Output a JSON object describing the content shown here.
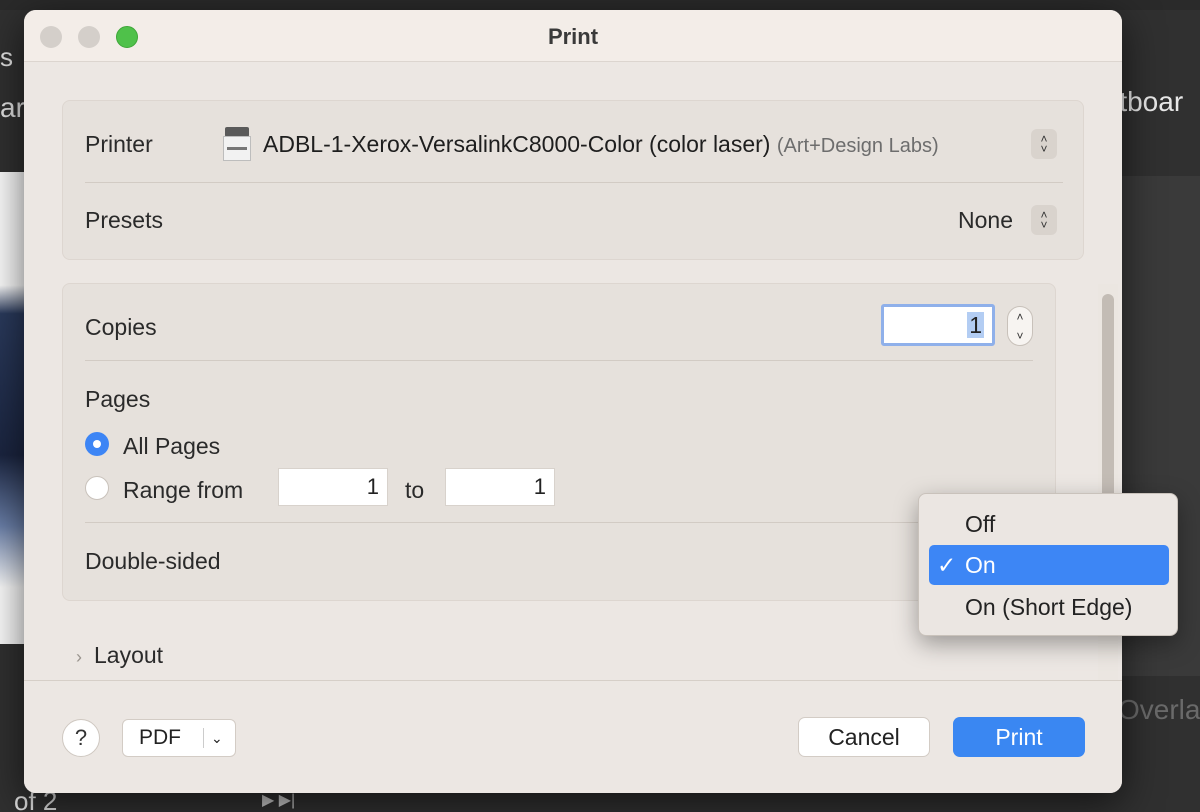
{
  "background": {
    "left_top": "s",
    "left_mid": "ar",
    "right_top": "rtboar",
    "right_bottom": "Overla",
    "page_indicator": "of 2"
  },
  "dialog": {
    "title": "Print",
    "printer": {
      "label": "Printer",
      "name": "ADBL-1-Xerox-VersalinkC8000-Color (color laser)",
      "location": "(Art+Design Labs)"
    },
    "presets": {
      "label": "Presets",
      "value": "None"
    },
    "copies": {
      "label": "Copies",
      "value": "1"
    },
    "pages": {
      "label": "Pages",
      "all_pages_label": "All Pages",
      "range_label": "Range from",
      "range_from": "1",
      "range_to_label": "to",
      "range_to": "1",
      "selected": "all"
    },
    "double_sided": {
      "label": "Double-sided"
    },
    "layout": {
      "label": "Layout"
    },
    "footer": {
      "help_label": "?",
      "pdf_label": "PDF",
      "cancel_label": "Cancel",
      "print_label": "Print"
    }
  },
  "double_sided_menu": {
    "options": [
      "Off",
      "On",
      "On (Short Edge)"
    ],
    "selected": "On",
    "check_mark": "✓"
  },
  "colors": {
    "accent": "#3a87f2",
    "dialog_bg": "#ece7e3"
  }
}
